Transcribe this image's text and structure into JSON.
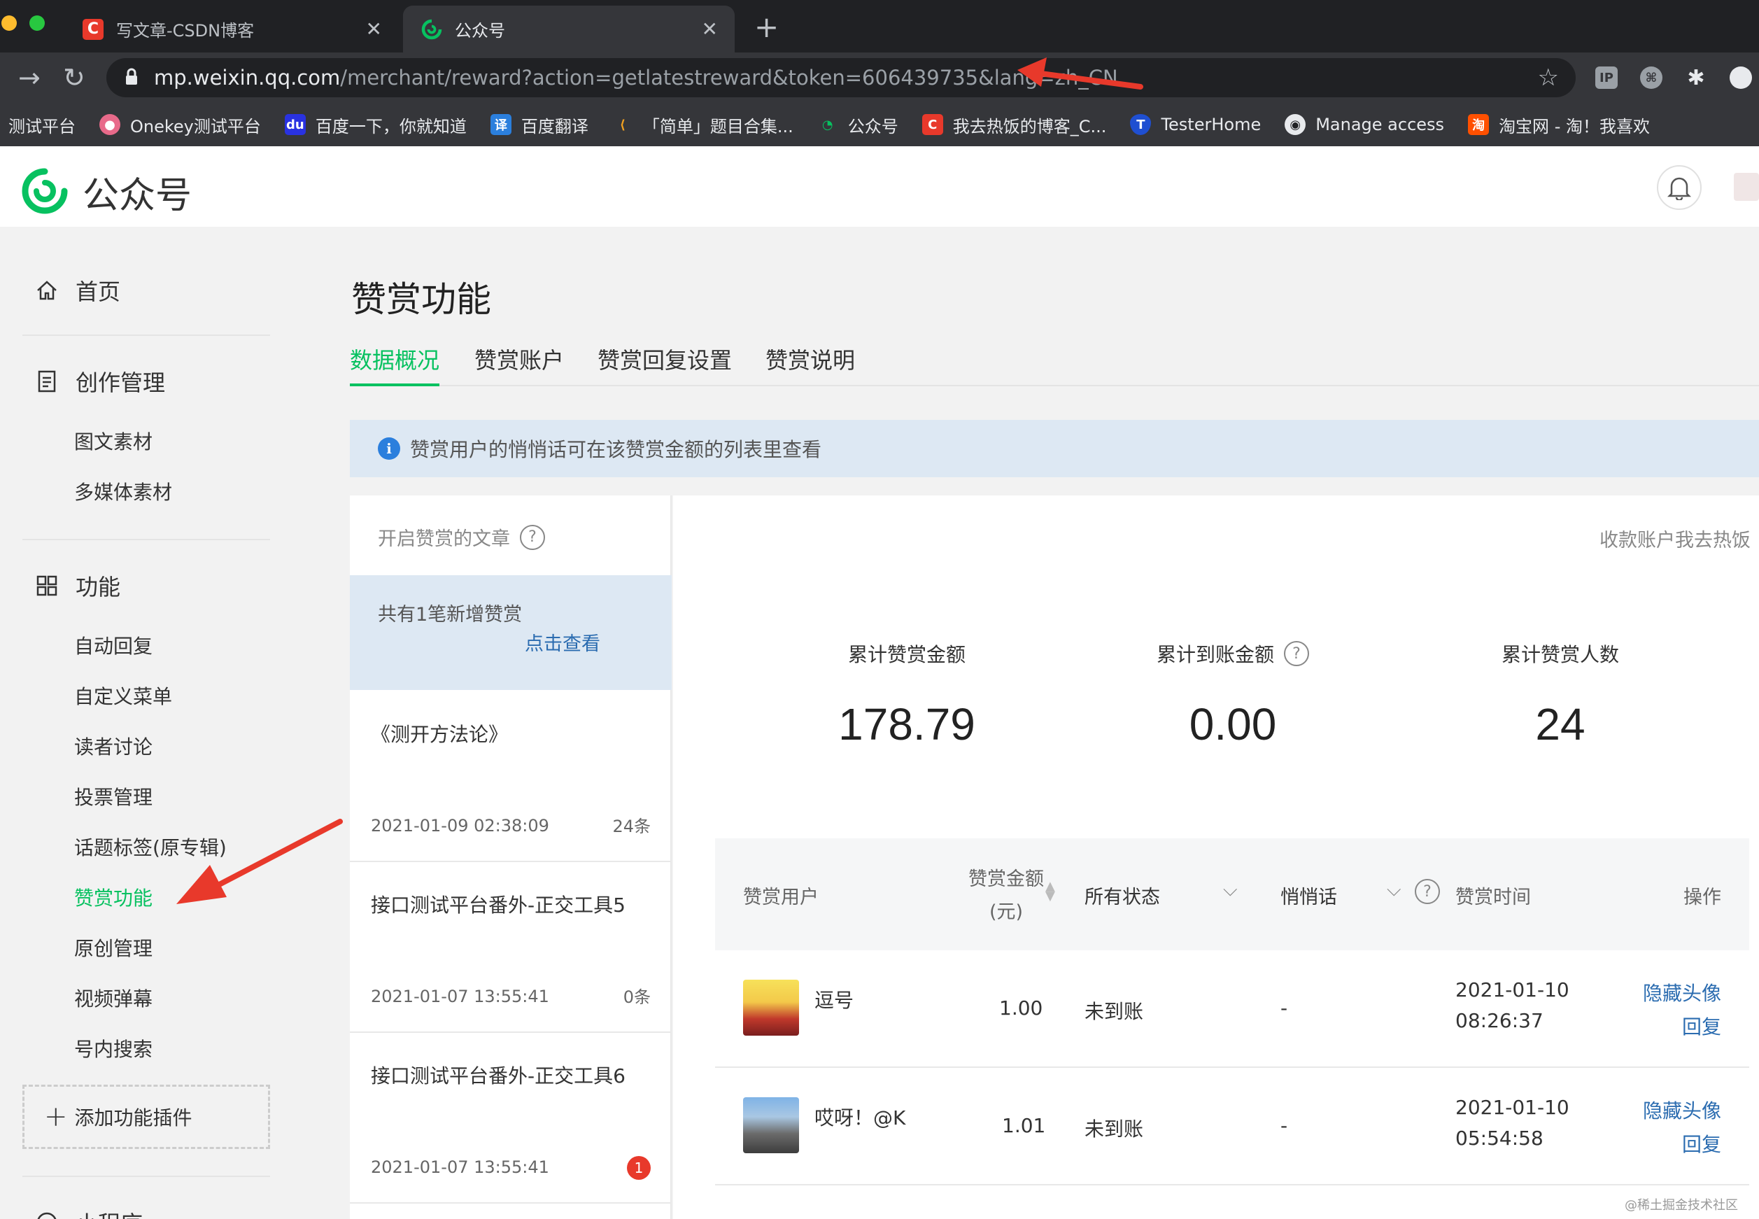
{
  "browser": {
    "tabs": [
      {
        "title": "写文章-CSDN博客",
        "favicon": "csdn-icon"
      },
      {
        "title": "公众号",
        "favicon": "wechat-mp-icon"
      }
    ],
    "url_host": "mp.weixin.qq.com",
    "url_path": "/merchant/reward?action=getlatestreward&token=606439735&lang=zh_CN",
    "bookmarks": [
      {
        "label": "测试平台"
      },
      {
        "label": "Onekey测试平台"
      },
      {
        "label": "百度一下，你就知道"
      },
      {
        "label": "百度翻译"
      },
      {
        "label": "「简单」题目合集..."
      },
      {
        "label": "公众号"
      },
      {
        "label": "我去热饭的博客_C..."
      },
      {
        "label": "TesterHome"
      },
      {
        "label": "Manage access"
      },
      {
        "label": "淘宝网 - 淘！我喜欢"
      }
    ]
  },
  "header": {
    "brand": "公众号"
  },
  "sidebar": {
    "home": "首页",
    "creation": "创作管理",
    "creation_items": [
      "图文素材",
      "多媒体素材"
    ],
    "features": "功能",
    "feature_items": [
      "自动回复",
      "自定义菜单",
      "读者讨论",
      "投票管理",
      "话题标签(原专辑)",
      "赞赏功能",
      "原创管理",
      "视频弹幕",
      "号内搜索"
    ],
    "active_item": "赞赏功能",
    "add_plugin": "添加功能插件",
    "next_section": "小程序"
  },
  "main": {
    "title": "赞赏功能",
    "tabs": [
      "数据概况",
      "赞赏账户",
      "赞赏回复设置",
      "赞赏说明"
    ],
    "notice": "赞赏用户的悄悄话可在该赞赏金额的列表里查看",
    "articles_header": "开启赞赏的文章",
    "new_rewards": "共有1笔新增赞赏",
    "view_link": "点击查看",
    "articles": [
      {
        "title": "《测开方法论》",
        "date": "2021-01-09 02:38:09",
        "count": "24条"
      },
      {
        "title": "接口测试平台番外-正交工具5",
        "date": "2021-01-07 13:55:41",
        "count": "0条"
      },
      {
        "title": "接口测试平台番外-正交工具6",
        "date": "2021-01-07 13:55:41",
        "badge": "1"
      }
    ],
    "account_label": "收款账户我去热饭",
    "stats": [
      {
        "label": "累计赞赏金额",
        "value": "178.79"
      },
      {
        "label": "累计到账金额",
        "value": "0.00"
      },
      {
        "label": "累计赞赏人数",
        "value": "24"
      }
    ],
    "table": {
      "columns": [
        "赞赏用户",
        "赞赏金额",
        "(元)",
        "所有状态",
        "悄悄话",
        "赞赏时间",
        "操作"
      ],
      "rows": [
        {
          "user": "逗号",
          "amount": "1.00",
          "status": "未到账",
          "message": "-",
          "date": "2021-01-10",
          "time": "08:26:37",
          "action1": "隐藏头像",
          "action2": "回复"
        },
        {
          "user": "哎呀！@K",
          "amount": "1.01",
          "status": "未到账",
          "message": "-",
          "date": "2021-01-10",
          "time": "05:54:58",
          "action1": "隐藏头像",
          "action2": "回复"
        }
      ]
    }
  },
  "watermark": "@稀土掘金技术社区",
  "colors": {
    "accent": "#07c160",
    "link": "#2b6cb0",
    "arrow": "#e8392b"
  }
}
